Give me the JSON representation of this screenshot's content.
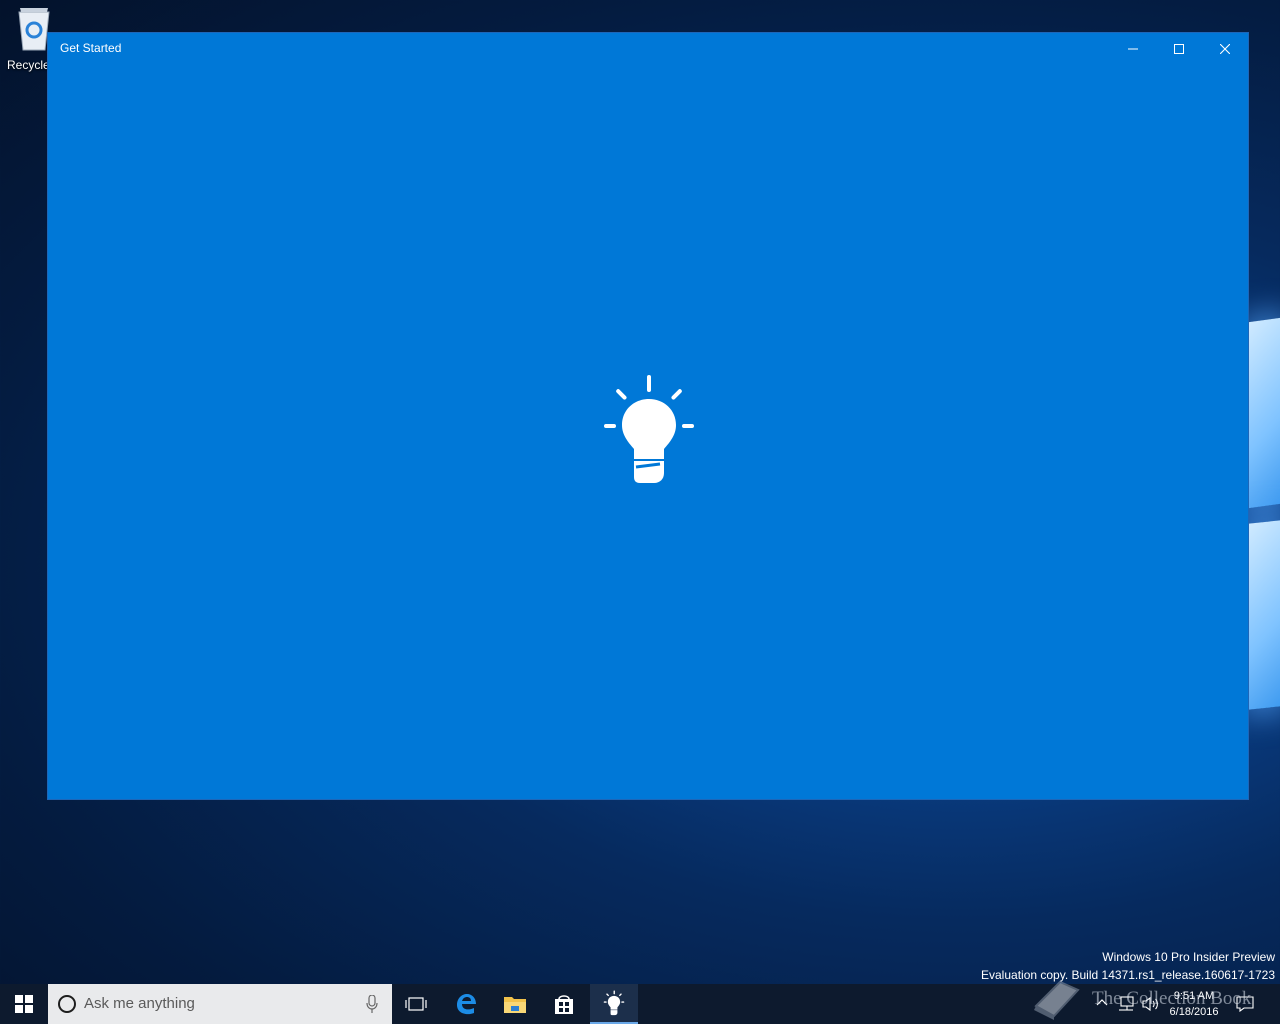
{
  "desktop": {
    "icons": [
      {
        "label": "Recycle"
      }
    ]
  },
  "window": {
    "title": "Get Started",
    "buttons": {
      "minimize": "minimize-icon",
      "maximize": "maximize-icon",
      "close": "close-icon"
    },
    "splash_icon": "lightbulb-icon",
    "background_color": "#0078d7"
  },
  "watermark": {
    "line1": "Windows 10 Pro Insider Preview",
    "line2": "Evaluation copy. Build 14371.rs1_release.160617-1723"
  },
  "taskbar": {
    "search": {
      "placeholder": "Ask me anything"
    },
    "pinned": [
      {
        "name": "task-view",
        "icon": "task-view-icon"
      },
      {
        "name": "edge",
        "icon": "edge-icon"
      },
      {
        "name": "file-explorer",
        "icon": "folder-icon"
      },
      {
        "name": "store",
        "icon": "store-icon"
      },
      {
        "name": "get-started",
        "icon": "lightbulb-icon",
        "active": true
      }
    ],
    "clock": {
      "time": "9:51 AM",
      "date": "6/18/2016"
    }
  },
  "brand_watermark": {
    "text": "The Collection Book"
  }
}
